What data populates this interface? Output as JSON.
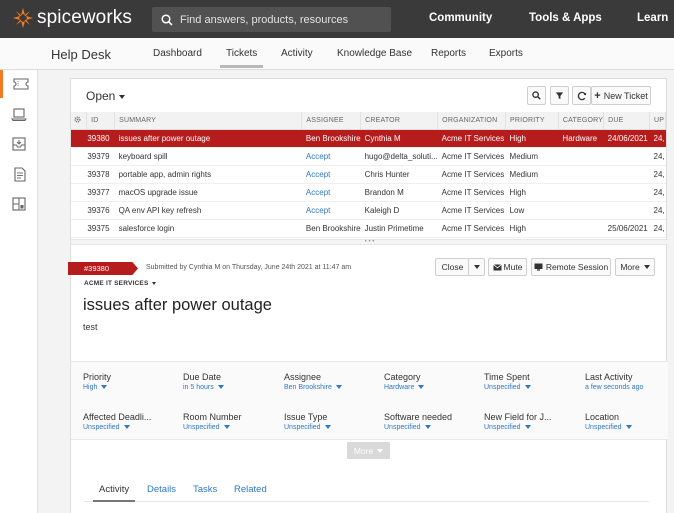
{
  "brand": {
    "name": "spiceworks",
    "accent": "#f27a21"
  },
  "search": {
    "placeholder": "Find answers, products, resources"
  },
  "topnav": {
    "community": "Community",
    "tools": "Tools & Apps",
    "learn": "Learn"
  },
  "subnav": {
    "title": "Help Desk",
    "tabs": [
      "Dashboard",
      "Tickets",
      "Activity",
      "Knowledge Base",
      "Reports",
      "Exports"
    ],
    "active": "Tickets"
  },
  "rail": {
    "icons": [
      "ticket-icon",
      "laptop-icon",
      "inbox-icon",
      "document-icon",
      "dashboard-icon"
    ]
  },
  "list": {
    "filter_label": "Open",
    "new_ticket_label": "New Ticket",
    "columns": [
      "ID",
      "SUMMARY",
      "ASSIGNEE",
      "CREATOR",
      "ORGANIZATION",
      "PRIORITY",
      "CATEGORY",
      "DUE",
      "UP"
    ],
    "rows": [
      {
        "id": "39380",
        "summary": "issues after power outage",
        "assignee": "Ben Brookshire",
        "creator": "Cynthia M",
        "organization": "Acme IT Services",
        "priority": "High",
        "category": "Hardware",
        "due": "24/06/2021",
        "up": "24,"
      },
      {
        "id": "39379",
        "summary": "keyboard spill",
        "assignee": "Accept",
        "creator": "hugo@delta_soluti...",
        "organization": "Acme IT Services",
        "priority": "Medium",
        "category": "",
        "due": "",
        "up": "24,"
      },
      {
        "id": "39378",
        "summary": "portable app, admin rights",
        "assignee": "Accept",
        "creator": "Chris Hunter",
        "organization": "Acme IT Services",
        "priority": "Medium",
        "category": "",
        "due": "",
        "up": "24,"
      },
      {
        "id": "39377",
        "summary": "macOS upgrade issue",
        "assignee": "Accept",
        "creator": "Brandon M",
        "organization": "Acme IT Services",
        "priority": "High",
        "category": "",
        "due": "",
        "up": "24,"
      },
      {
        "id": "39376",
        "summary": "QA env API key refresh",
        "assignee": "Accept",
        "creator": "Kaleigh D",
        "organization": "Acme IT Services",
        "priority": "Low",
        "category": "",
        "due": "",
        "up": "24,"
      },
      {
        "id": "39375",
        "summary": "salesforce login",
        "assignee": "Ben Brookshire",
        "creator": "Justin Primetime",
        "organization": "Acme IT Services",
        "priority": "High",
        "category": "",
        "due": "25/06/2021",
        "up": "24,"
      }
    ],
    "selected_color": "#b71c1c"
  },
  "ticket": {
    "tag": "#39380",
    "submitted": "Submitted by Cynthia M on Thursday, June 24th 2021 at 11:47 am",
    "organization": "ACME IT SERVICES",
    "title": "issues after power outage",
    "description": "test",
    "buttons": {
      "close": "Close",
      "mute": "Mute",
      "remote": "Remote Session",
      "more": "More"
    },
    "attributes": [
      {
        "label": "Priority",
        "value": "High"
      },
      {
        "label": "Due Date",
        "value": "in 5 hours"
      },
      {
        "label": "Assignee",
        "value": "Ben Brookshire"
      },
      {
        "label": "Category",
        "value": "Hardware"
      },
      {
        "label": "Time Spent",
        "value": "Unspecified"
      },
      {
        "label": "Last Activity",
        "value": "a few seconds ago"
      },
      {
        "label": "Affected Deadli...",
        "value": "Unspecified"
      },
      {
        "label": "Room Number",
        "value": "Unspecified"
      },
      {
        "label": "Issue Type",
        "value": "Unspecified"
      },
      {
        "label": "Software needed",
        "value": "Unspecified"
      },
      {
        "label": "New Field for J...",
        "value": "Unspecified"
      },
      {
        "label": "Location",
        "value": "Unspecified"
      }
    ],
    "more_label": "More",
    "tabs": [
      "Activity",
      "Details",
      "Tasks",
      "Related"
    ],
    "active_tab": "Activity"
  }
}
